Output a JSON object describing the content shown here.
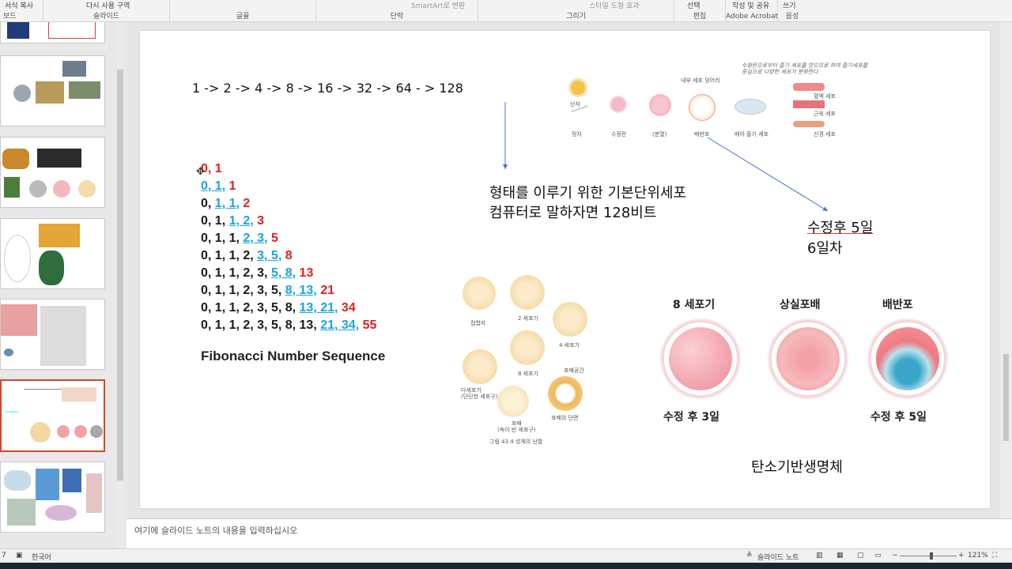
{
  "ribbon": {
    "groups": [
      {
        "top": "서식 복사",
        "label": "보드"
      },
      {
        "top": "다시 사용  구역",
        "label": "슬라이드"
      },
      {
        "top": "",
        "label": "글꼴"
      },
      {
        "top": "SmartArt로 변환",
        "label": "단락"
      },
      {
        "top": "스타일  도형 효과",
        "label": "그리기"
      },
      {
        "top": "선택",
        "label": "편집"
      },
      {
        "top": "작성 및 공유",
        "label": "Adobe Acrobat"
      },
      {
        "top": "쓰기",
        "label": "음성"
      }
    ]
  },
  "slide": {
    "sequence": "1 -> 2 -> 4 -> 8 -> 16 -> 32 -> 64 - > 128",
    "fibonacci": {
      "rows": [
        {
          "plain": "",
          "blue": "",
          "red": "0, 1"
        },
        {
          "plain": "",
          "blue": "0, 1,",
          "red": " 1"
        },
        {
          "plain": "0, ",
          "blue": "1, 1,",
          "red": " 2"
        },
        {
          "plain": "0, 1, ",
          "blue": "1, 2,",
          "red": " 3"
        },
        {
          "plain": "0, 1, 1, ",
          "blue": "2, 3,",
          "red": " 5"
        },
        {
          "plain": "0, 1, 1, 2, ",
          "blue": "3, 5,",
          "red": " 8"
        },
        {
          "plain": "0, 1, 1, 2, 3, ",
          "blue": "5, 8,",
          "red": " 13"
        },
        {
          "plain": "0, 1, 1, 2, 3, 5, ",
          "blue": "8, 13,",
          "red": " 21"
        },
        {
          "plain": "0, 1, 1, 2, 3, 5, 8, ",
          "blue": "13, 21,",
          "red": " 34"
        },
        {
          "plain": "0, 1, 1, 2, 3, 5, 8, 13, ",
          "blue": "21, 34,",
          "red": " 55"
        }
      ],
      "title": "Fibonacci Number Sequence"
    },
    "cell_text_1": "형태를 이루기 위한 기본단위세포",
    "cell_text_2": "컴퓨터로 말하자면 128비트",
    "day_text_1": "수정후 5일",
    "day_text_2": "6일차",
    "carbon_text": "탄소기반생명체",
    "diagram_top": {
      "handwritten": "수정란으로부터 줄기 세포를 얻으므로 하여 줄기세포를 중심으로 다양한 세포가 분화한다",
      "labels": [
        "난자",
        "정자",
        "수정란",
        "(분열)",
        "배반포",
        "내부 세포 덩어리",
        "배아 줄기 세포",
        "혈액 세포",
        "근육 세포",
        "신경 세포"
      ]
    },
    "diagram_cleavage": {
      "labels": [
        "접합자",
        "2 세포기",
        "4 세포기",
        "8 세포기",
        "다세포기\n(단단한 세포구)",
        "포배공간",
        "포배\n(속이 빈 세포구)",
        "포배의 단면"
      ],
      "caption": "그림 43.4  성게의 난할"
    },
    "embryo": {
      "stages": [
        "8 세포기",
        "상실포배",
        "배반포"
      ],
      "captions": [
        "수정 후 3일",
        "수정 후 5일"
      ]
    }
  },
  "notes_placeholder": "여기에 슬라이드 노트의 내용을 입력하십시오",
  "status": {
    "slide_num": "7",
    "language": "한국어",
    "notes_button": "슬라이드 노트",
    "zoom": "121%"
  }
}
